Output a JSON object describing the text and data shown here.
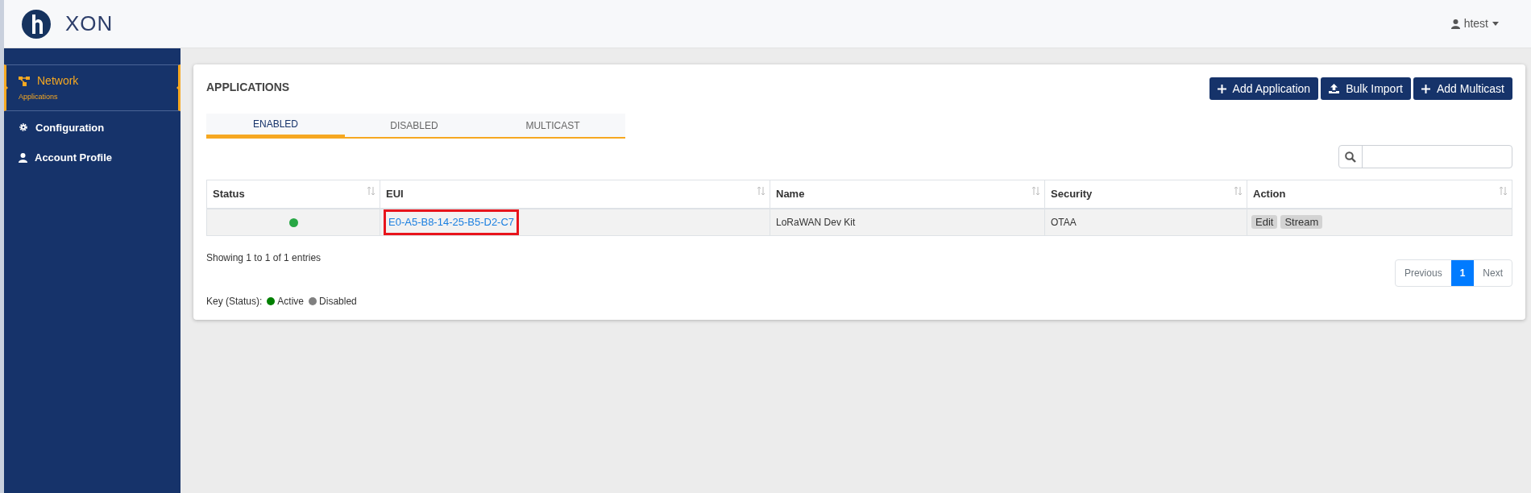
{
  "header": {
    "logo_text": "XON",
    "user": "htest"
  },
  "sidebar": {
    "items": [
      {
        "label": "Network",
        "sublabel": "Applications",
        "kind": "network",
        "selected": true
      },
      {
        "label": "Configuration",
        "kind": "gear",
        "selected": false
      },
      {
        "label": "Account Profile",
        "kind": "user",
        "selected": false
      }
    ]
  },
  "panel": {
    "title": "APPLICATIONS",
    "buttons": [
      {
        "label": "Add Application",
        "kind": "plus"
      },
      {
        "label": "Bulk Import",
        "kind": "upload"
      },
      {
        "label": "Add Multicast",
        "kind": "plus"
      }
    ],
    "tabs": [
      {
        "label": "ENABLED",
        "selected": true
      },
      {
        "label": "DISABLED",
        "selected": false
      },
      {
        "label": "MULTICAST",
        "selected": false
      }
    ],
    "table": {
      "columns": [
        "Status",
        "EUI",
        "Name",
        "Security",
        "Action"
      ],
      "rows": [
        {
          "color": "#28a745",
          "eui": "E0-A5-B8-14-25-B5-D2-C7",
          "eui_highlighted": true,
          "name": "LoRaWAN Dev Kit",
          "security": "OTAA",
          "actions": [
            "Edit",
            "Stream"
          ]
        }
      ]
    },
    "info": "Showing 1 to 1 of 1 entries",
    "pagination": [
      {
        "label": "Previous",
        "selected": false
      },
      {
        "label": "1",
        "selected": true
      },
      {
        "label": "Next",
        "selected": false
      }
    ],
    "key": {
      "label": "Key (Status):",
      "items": [
        {
          "label": "Active",
          "color": "#008000"
        },
        {
          "label": "Disabled",
          "color": "#808080"
        }
      ]
    }
  }
}
